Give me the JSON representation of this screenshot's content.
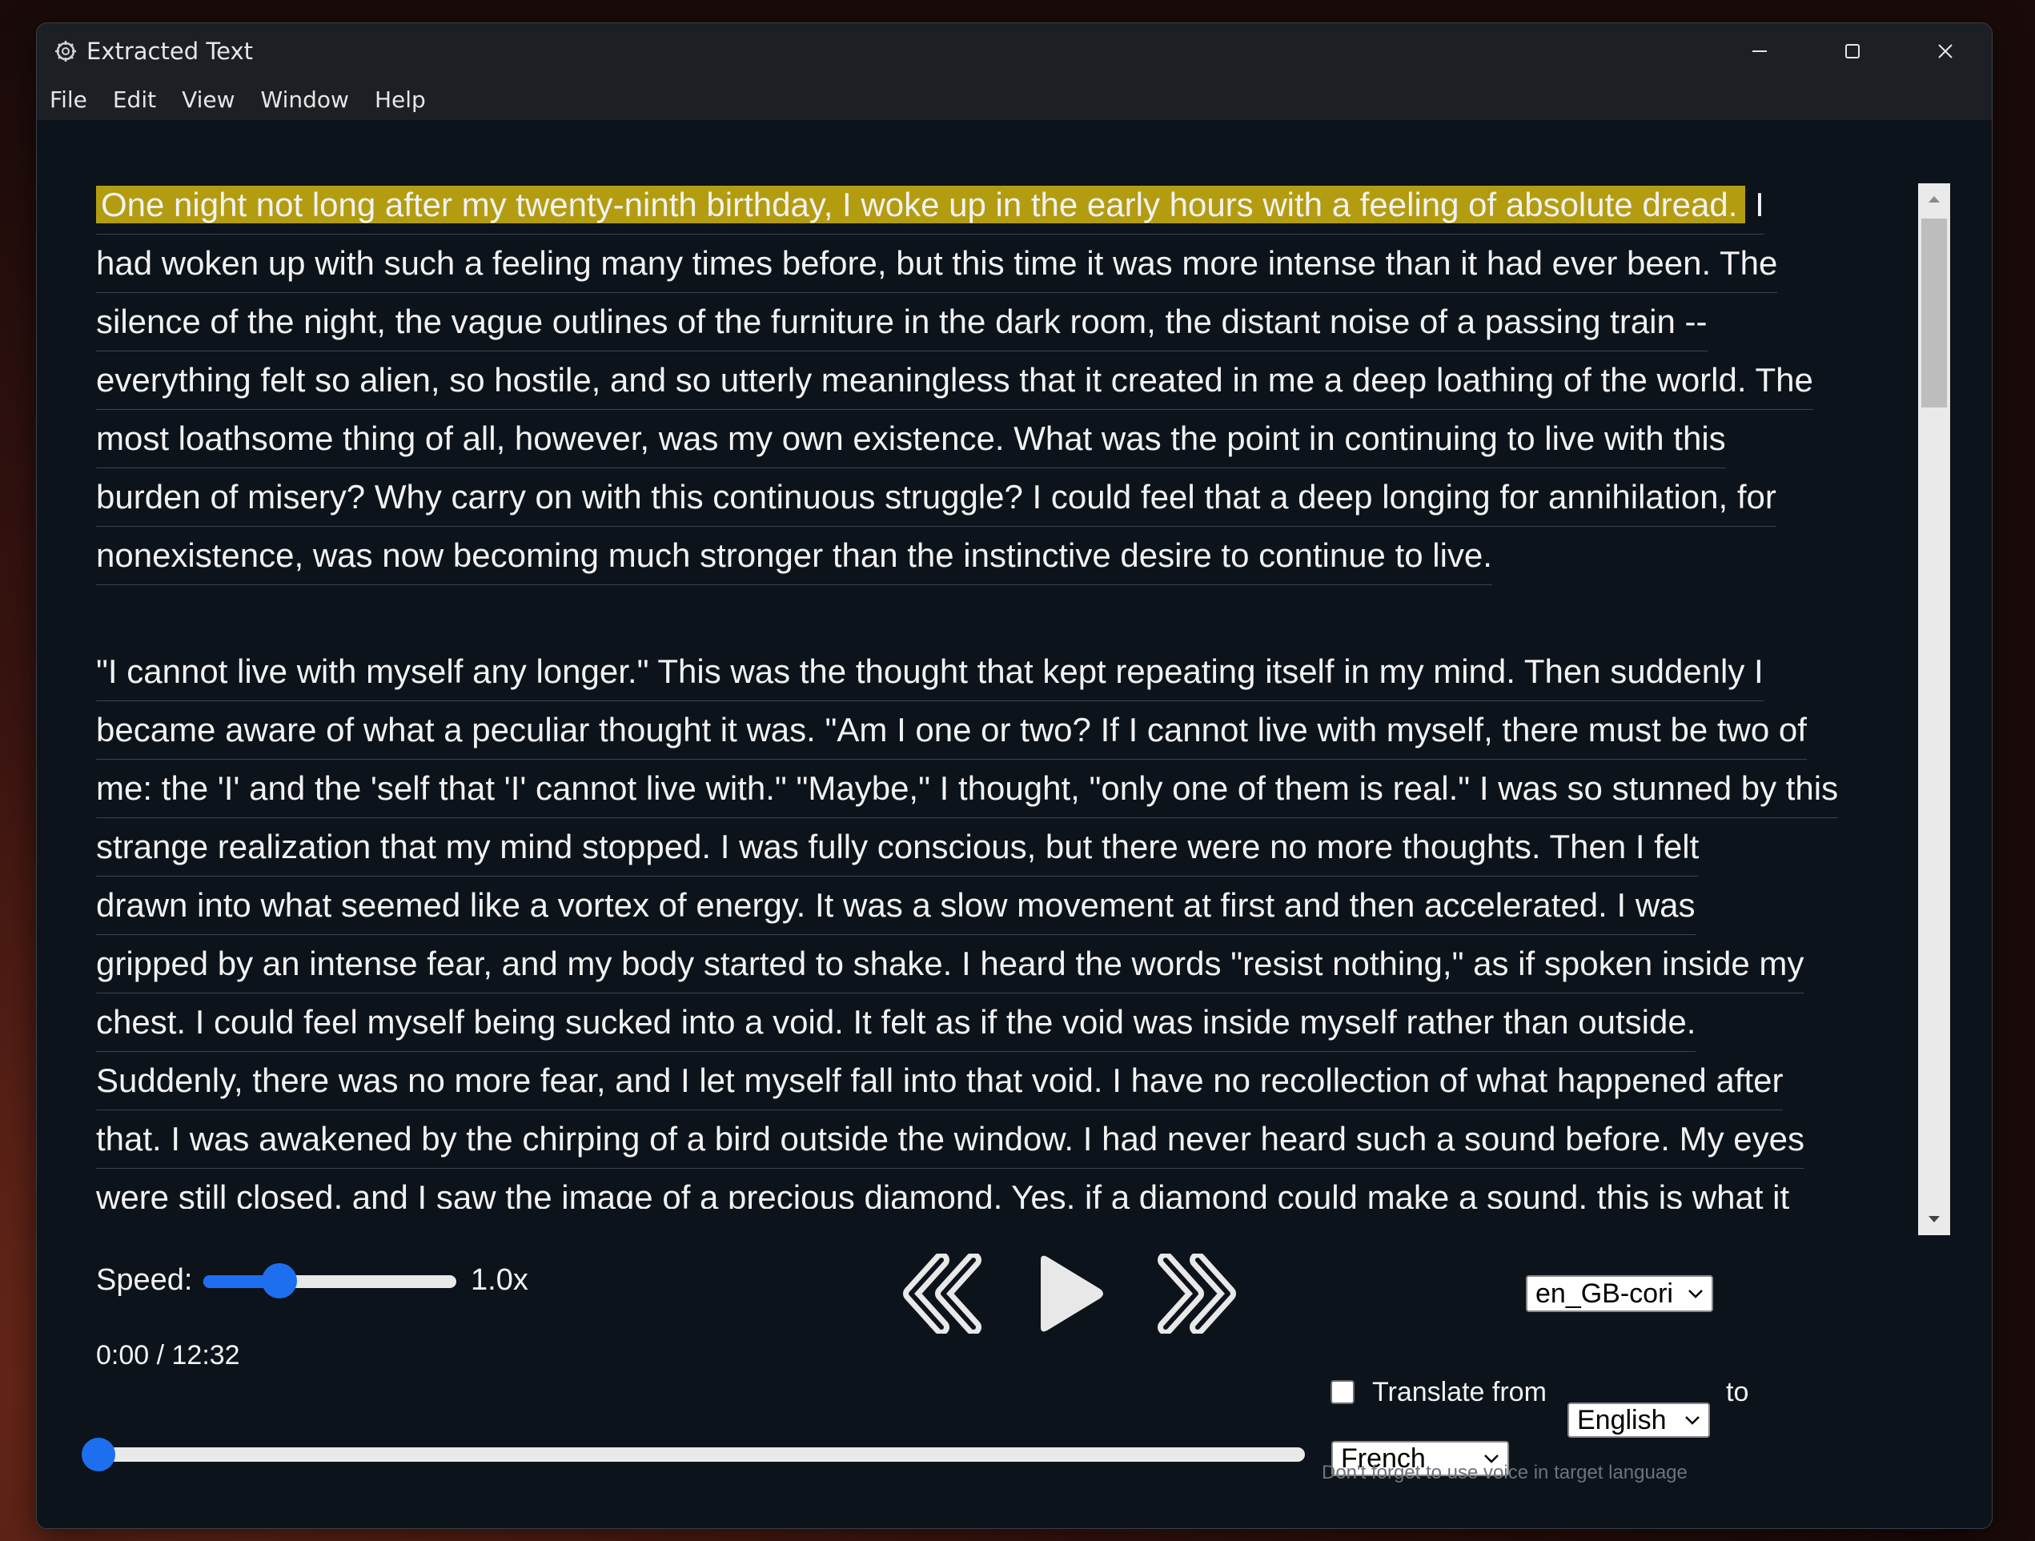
{
  "window": {
    "title": "Extracted Text",
    "app_icon": "gear-app-icon",
    "controls": [
      "minimize-icon",
      "maximize-icon",
      "close-icon"
    ]
  },
  "menu": [
    "File",
    "Edit",
    "View",
    "Window",
    "Help"
  ],
  "text": {
    "lines": [
      {
        "text": "One night not long after my twenty-ninth birthday, I woke up in the early hours with a feeling of absolute dread.",
        "highlighted": true,
        "tail": " I"
      },
      {
        "text": "had woken up with such a feeling many times before, but this time it was more intense than it had ever been.  The"
      },
      {
        "text": "silence of the night, the vague outlines of the furniture in the dark room, the distant noise of a passing train --"
      },
      {
        "text": "everything felt so alien, so hostile, and so utterly meaningless that it created in me a deep loathing of the world.  The"
      },
      {
        "text": "most loathsome thing of all, however, was my own existence.  What was the point in continuing to live with this"
      },
      {
        "text": "burden of misery?  Why carry on with this continuous struggle?  I could feel that a deep longing for annihilation, for"
      },
      {
        "text": "nonexistence, was now becoming much stronger than the instinctive desire to continue to live."
      },
      {
        "text": "",
        "blank": true
      },
      {
        "text": "\"I cannot live with myself any longer.\" This was the thought that kept repeating itself in my mind.  Then suddenly I"
      },
      {
        "text": "became aware of what a peculiar thought it was. \"Am I one or two?  If I cannot live with myself, there must be two of"
      },
      {
        "text": "me: the 'I' and the 'self that 'I' cannot live with.\" \"Maybe,\" I thought, \"only one of them is real.\" I was so stunned by this"
      },
      {
        "text": "strange realization that my mind stopped.  I was fully conscious, but there were no more thoughts.  Then I felt"
      },
      {
        "text": "drawn into what seemed like a vortex of energy.  It was a slow movement at first and then accelerated.  I was"
      },
      {
        "text": "gripped by an intense fear, and my body started to shake.  I heard the words \"resist nothing,\" as if spoken inside my"
      },
      {
        "text": "chest.  I could feel myself being sucked into a void.  It felt as if the void was inside myself rather than outside."
      },
      {
        "text": " Suddenly, there was no more fear, and I let myself fall into that void.  I have no recollection of what happened after"
      },
      {
        "text": "that.  I was awakened by the chirping of a bird outside the window.  I had never heard such a sound before.  My eyes"
      },
      {
        "text": "were still closed, and I saw the image of a precious diamond.  Yes, if a diamond could make a sound, this is what it"
      }
    ]
  },
  "controls": {
    "speed_label": "Speed:",
    "speed_value": "1.0x",
    "speed_fraction": 0.27,
    "time": "0:00 / 12:32",
    "progress_fraction": 0.0,
    "voice": "en_GB-cori",
    "translate_checked": false,
    "translate_label": "Translate from",
    "from_language": "English",
    "to_label": "to",
    "to_language": "French",
    "hint": "Don't forget to use voice in target language",
    "transport_icons": [
      "rewind-icon",
      "play-icon",
      "fast-forward-icon"
    ]
  },
  "colors": {
    "highlight": "#b39c10",
    "accent": "#1d6ff0",
    "background": "#0d131b"
  }
}
